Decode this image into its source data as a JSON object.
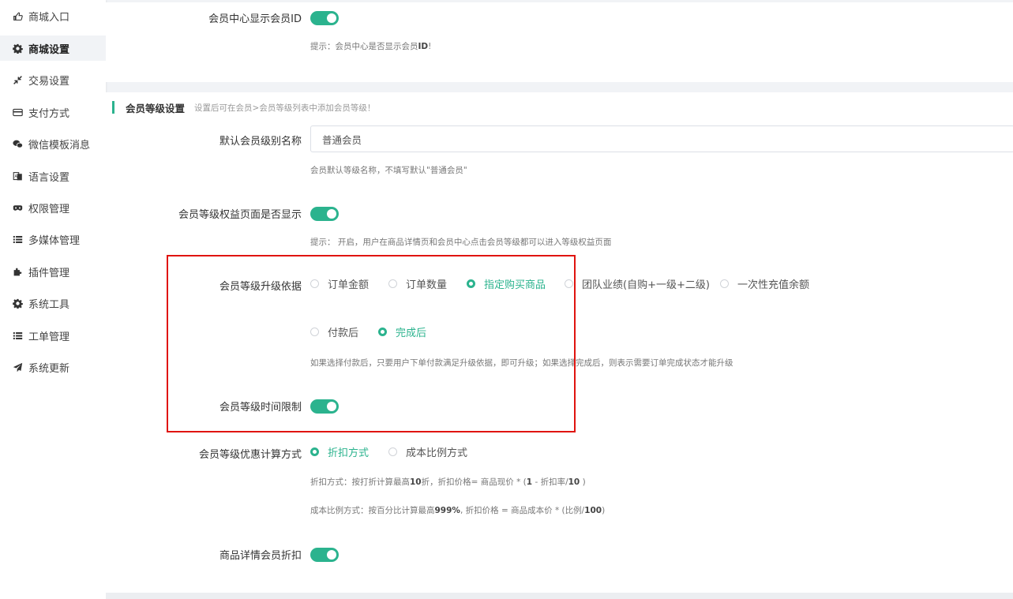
{
  "sidebar": {
    "items": [
      {
        "label": "商城入口",
        "icon": "hand-point-icon"
      },
      {
        "label": "商城设置",
        "icon": "gear-icon"
      },
      {
        "label": "交易设置",
        "icon": "exchange-icon"
      },
      {
        "label": "支付方式",
        "icon": "credit-card-icon"
      },
      {
        "label": "微信模板消息",
        "icon": "wechat-icon"
      },
      {
        "label": "语言设置",
        "icon": "translate-icon"
      },
      {
        "label": "权限管理",
        "icon": "mask-icon"
      },
      {
        "label": "多媒体管理",
        "icon": "list-icon"
      },
      {
        "label": "插件管理",
        "icon": "puzzle-icon"
      },
      {
        "label": "系统工具",
        "icon": "gear-icon"
      },
      {
        "label": "工单管理",
        "icon": "list-icon"
      },
      {
        "label": "系统更新",
        "icon": "paper-plane-icon"
      }
    ],
    "active_index": 1
  },
  "member_id": {
    "label": "会员中心显示会员ID",
    "enabled": true,
    "hint_prefix": "提示：会员中心是否显示会员",
    "hint_bold": "ID",
    "hint_suffix": "!"
  },
  "level_section": {
    "title": "会员等级设置",
    "subtitle": "设置后可在会员>会员等级列表中添加会员等级！",
    "default_name": {
      "label": "默认会员级别名称",
      "value": "普通会员",
      "hint": "会员默认等级名称，不填写默认\"普通会员\""
    },
    "rights_page": {
      "label": "会员等级权益页面是否显示",
      "enabled": true,
      "hint": "提示： 开启，用户在商品详情页和会员中心点击会员等级都可以进入等级权益页面"
    },
    "upgrade_basis": {
      "label": "会员等级升级依据",
      "options": [
        "订单金额",
        "订单数量",
        "指定购买商品",
        "团队业绩(自购+一级+二级)",
        "一次性充值余额"
      ],
      "selected": 2
    },
    "upgrade_timing": {
      "options": [
        "付款后",
        "完成后"
      ],
      "selected": 1,
      "hint": "如果选择付款后，只要用户下单付款满足升级依据，即可升级；如果选择完成后，则表示需要订单完成状态才能升级"
    },
    "time_limit": {
      "label": "会员等级时间限制",
      "enabled": true
    },
    "discount_method": {
      "label": "会员等级优惠计算方式",
      "options": [
        "折扣方式",
        "成本比例方式"
      ],
      "selected": 0,
      "hint1_a": "折扣方式：按打折计算最高",
      "hint1_b": "10",
      "hint1_c": "折，折扣价格= 商品现价 * (",
      "hint1_d": "1",
      "hint1_e": " - 折扣率/",
      "hint1_f": "10",
      "hint1_g": " )",
      "hint2_a": "成本比例方式：按百分比计算最高",
      "hint2_b": "999%",
      "hint2_c": ", 折扣价格 = 商品成本价 * (比例/",
      "hint2_d": "100",
      "hint2_e": ")"
    },
    "detail_discount": {
      "label": "商品详情会员折扣",
      "enabled": true
    }
  },
  "colors": {
    "accent": "#2bb38e",
    "highlight_border": "#e0140f"
  }
}
